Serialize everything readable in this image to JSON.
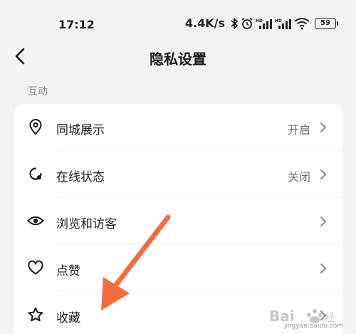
{
  "status_bar": {
    "time": "17:12",
    "network_speed": "4.4K/s",
    "battery": "59",
    "icons": [
      "bluetooth-icon",
      "alarm-icon",
      "signal-hd-icon",
      "signal-hd-icon",
      "wifi-icon",
      "battery-icon"
    ]
  },
  "header": {
    "title": "隐私设置",
    "back_icon": "chevron-left-icon"
  },
  "section": {
    "title": "互动"
  },
  "settings": [
    {
      "label": "同城展示",
      "value": "开启",
      "icon": "location-pin-icon"
    },
    {
      "label": "在线状态",
      "value": "关闭",
      "icon": "online-status-icon"
    },
    {
      "label": "浏览和访客",
      "value": "",
      "icon": "eye-icon"
    },
    {
      "label": "点赞",
      "value": "",
      "icon": "heart-icon"
    },
    {
      "label": "收藏",
      "value": "",
      "icon": "star-icon"
    }
  ],
  "annotation": {
    "color": "#f26d3d"
  },
  "watermark": {
    "url": "jingyan.baidu.com"
  }
}
